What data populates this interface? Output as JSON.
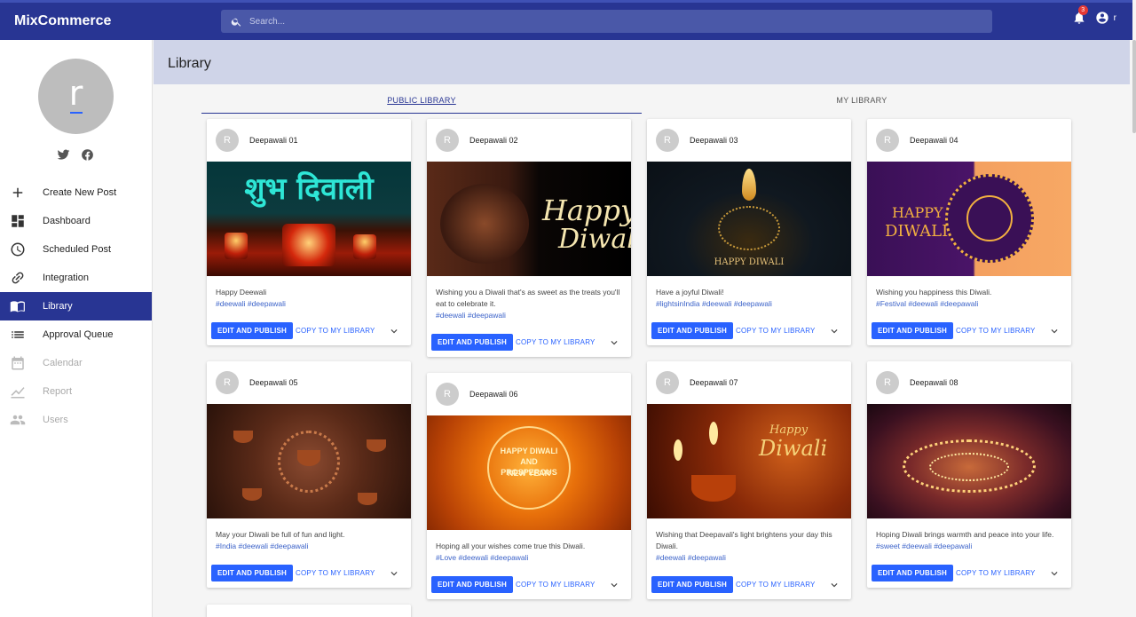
{
  "app": {
    "brand": "MixCommerce",
    "search_placeholder": "Search...",
    "notification_count": "3",
    "user_initial": "r"
  },
  "sidebar": {
    "avatar_letter": "r",
    "items": [
      {
        "label": "Create New Post",
        "icon": "plus-icon"
      },
      {
        "label": "Dashboard",
        "icon": "dashboard-icon"
      },
      {
        "label": "Scheduled Post",
        "icon": "clock-icon"
      },
      {
        "label": "Integration",
        "icon": "link-icon"
      },
      {
        "label": "Library",
        "icon": "book-icon"
      },
      {
        "label": "Approval Queue",
        "icon": "list-icon"
      },
      {
        "label": "Calendar",
        "icon": "calendar-icon"
      },
      {
        "label": "Report",
        "icon": "chart-icon"
      },
      {
        "label": "Users",
        "icon": "users-icon"
      }
    ]
  },
  "page": {
    "title": "Library",
    "tabs": [
      "PUBLIC LIBRARY",
      "MY LIBRARY"
    ]
  },
  "cards": [
    {
      "title": "Deepawali 01",
      "caption": "Happy Deewali",
      "tags": "#deewali #deepawali",
      "image_text": "शुभ दिवाली",
      "image_text2": ""
    },
    {
      "title": "Deepawali 02",
      "caption": "Wishing you a Diwali that's as sweet as the treats you'll eat to celebrate it.",
      "tags": "#deewali #deepawali",
      "image_text": "Happy",
      "image_text2": "Diwali"
    },
    {
      "title": "Deepawali 03",
      "caption": "Have a joyful Diwali!",
      "tags": "#lightsinIndia #deewali #deepawali",
      "image_text": "HAPPY DIWALI",
      "image_text2": ""
    },
    {
      "title": "Deepawali 04",
      "caption": "Wishing you happiness this Diwali.",
      "tags": "#Festival #deewali #deepawali",
      "image_text": "HAPPY",
      "image_text2": "DIWALI"
    },
    {
      "title": "Deepawali 05",
      "caption": "May your Diwali be full of fun and light.",
      "tags": "#India #deewali #deepawali",
      "image_text": "",
      "image_text2": ""
    },
    {
      "title": "Deepawali 06",
      "caption": "Hoping all your wishes come true this Diwali.",
      "tags": "#Love #deewali #deepawali",
      "image_text": "HAPPY DIWALI AND PROSPEROUS",
      "image_text2": "NEW YEAR"
    },
    {
      "title": "Deepawali 07",
      "caption": "Wishing that Deepavali's light brightens your day this Diwali.",
      "tags": "#deewali #deepawali",
      "image_text": "Happy",
      "image_text2": "Diwali"
    },
    {
      "title": "Deepawali 08",
      "caption": "Hoping Diwali brings warmth and peace into your life.",
      "tags": "#sweet #deewali #deepawali",
      "image_text": "",
      "image_text2": ""
    }
  ],
  "card_actions": {
    "publish": "EDIT AND PUBLISH",
    "copy": "COPY TO MY LIBRARY",
    "avatar": "R"
  }
}
